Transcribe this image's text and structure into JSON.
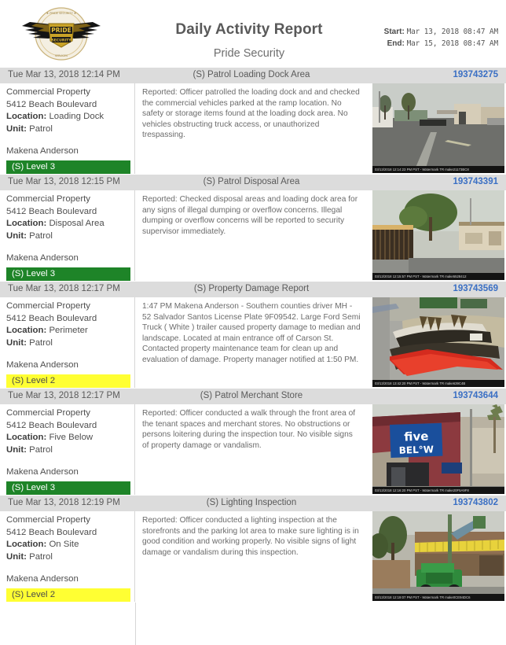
{
  "header": {
    "logo_alt": "Pride Security winged badge logo",
    "title": "Daily Activity Report",
    "subtitle": "Pride Security",
    "start_label": "Start:",
    "start_value": "Mar 13, 2018 08:47 AM",
    "end_label": "End:",
    "end_value": "Mar 15, 2018 08:47 AM"
  },
  "reports": [
    {
      "time": "Tue Mar 13, 2018 12:14 PM",
      "title": "(S) Patrol Loading Dock Area",
      "id": "193743275",
      "property_type": "Commercial Property",
      "address": "5412 Beach Boulevard",
      "location_label": "Location:",
      "location_value": "Loading Dock",
      "unit_label": "Unit:",
      "unit_value": "Patrol",
      "officer": "Makena Anderson",
      "level": "(S) Level 3",
      "level_color": "green",
      "narrative": "Reported: Officer patrolled the loading dock and and checked the commercial vehicles parked at the ramp location. No safety or storage items found at the loading dock area. No vehicles obstructing truck access, or unauthorized trespassing.",
      "photo_caption": "03/13/2018 12:14:23 PM PST - Watermark TR make21173BC8",
      "photo_scene": "parking-lot"
    },
    {
      "time": "Tue Mar 13, 2018 12:15 PM",
      "title": "(S) Patrol Disposal Area",
      "id": "193743391",
      "property_type": "Commercial Property",
      "address": "5412 Beach Boulevard",
      "location_label": "Location:",
      "location_value": "Disposal Area",
      "unit_label": "Unit:",
      "unit_value": "Patrol",
      "officer": "Makena Anderson",
      "level": "(S) Level 3",
      "level_color": "green",
      "narrative": "Reported: Checked disposal areas and loading dock area for any signs of illegal dumping or overflow concerns.  Illegal dumping or overflow concerns will be reported to security supervisor immediately.",
      "photo_caption": "03/13/2018 12:15:57 PM PST - Watermark TR make5528412",
      "photo_scene": "gate-tree"
    },
    {
      "time": "Tue Mar 13, 2018 12:17 PM",
      "title": "(S) Property Damage Report",
      "id": "193743569",
      "property_type": "Commercial Property",
      "address": "5412 Beach Boulevard",
      "location_label": "Location:",
      "location_value": "Perimeter",
      "unit_label": "Unit:",
      "unit_value": "Patrol",
      "officer": "Makena Anderson",
      "level": "(S) Level 2",
      "level_color": "yellow",
      "narrative": "1:47 PM Makena Anderson - Southern counties driver MH - 52 Salvador Santos License Plate 9F09542. Large Ford Semi Truck ( White ) trailer caused property damage to median and landscape. Located at main entrance off of Carson St. Contacted property maintenance team for clean up and evaluation of damage. Property manager notified at 1:50 PM.",
      "photo_caption": "03/13/2018 13:42:20 PM PST - Watermark TR make639C4B",
      "photo_scene": "damaged-median"
    },
    {
      "time": "Tue Mar 13, 2018 12:17 PM",
      "title": "(S) Patrol Merchant Store",
      "id": "193743644",
      "property_type": "Commercial Property",
      "address": "5412 Beach Boulevard",
      "location_label": "Location:",
      "location_value": "Five Below",
      "unit_label": "Unit:",
      "unit_value": "Patrol",
      "officer": "Makena Anderson",
      "level": "(S) Level 3",
      "level_color": "green",
      "narrative": "Reported: Officer conducted a walk through the front area of the tenant spaces and merchant stores. No obstructions or persons loitering during the inspection tour. No visible signs of property damage or vandalism.",
      "photo_caption": "03/13/2018 12:16:20 PM PST - Watermark TR make20F5A9F8",
      "photo_scene": "five-below-store"
    },
    {
      "time": "Tue Mar 13, 2018 12:19 PM",
      "title": "(S) Lighting Inspection",
      "id": "193743802",
      "property_type": "Commercial Property",
      "address": "5412 Beach Boulevard",
      "location_label": "Location:",
      "location_value": "On Site",
      "unit_label": "Unit:",
      "unit_value": "Patrol",
      "officer": "Makena Anderson",
      "level": "(S) Level 2",
      "level_color": "yellow",
      "narrative": "Reported: Officer conducted a lighting inspection at the storefronts and the parking lot area to make sure lighting is in good condition and working properly. No visible signs of light damage or vandalism during this inspection.",
      "photo_caption": "03/13/2018 12:19:07 PM PST - Watermark TR make0CE94DC6",
      "photo_scene": "green-lift"
    }
  ],
  "colors": {
    "bar_background": "#dcdcdc",
    "report_id": "#3a6fc4",
    "level_green": "#1e8428",
    "level_yellow": "#ffff33",
    "title_text": "#595959"
  }
}
